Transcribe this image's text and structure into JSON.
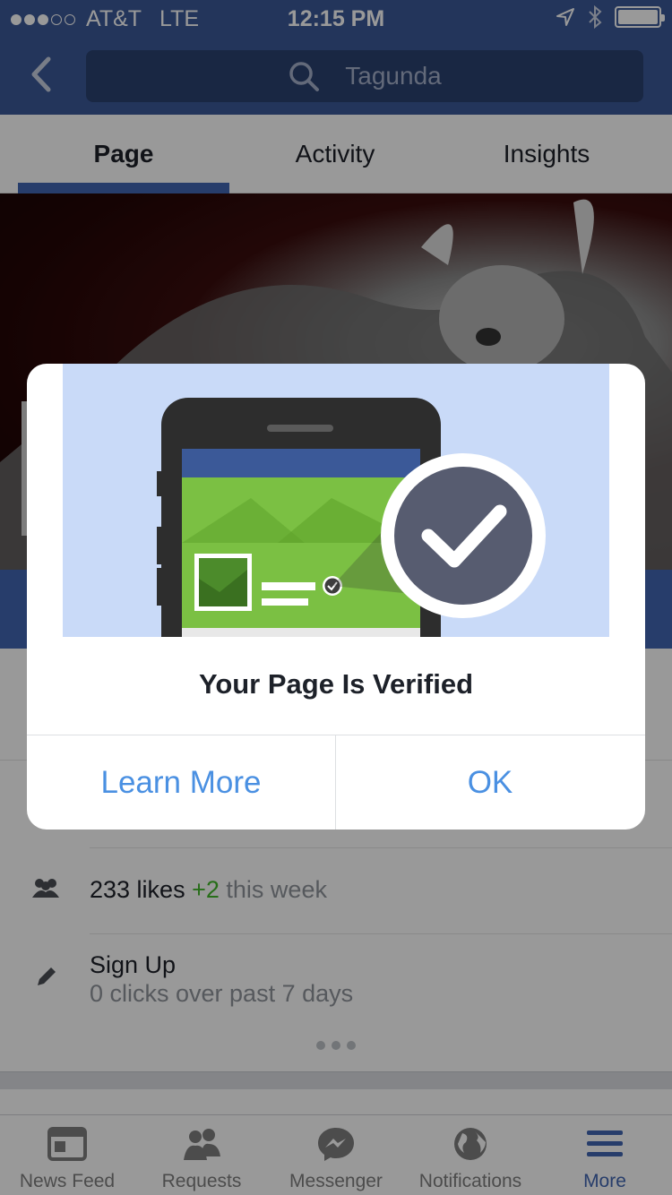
{
  "status_bar": {
    "carrier": "AT&T",
    "network": "LTE",
    "time": "12:15 PM"
  },
  "search": {
    "query": "Tagunda"
  },
  "tabs": [
    {
      "label": "Page"
    },
    {
      "label": "Activity"
    },
    {
      "label": "Insights"
    }
  ],
  "stats": {
    "likes_count": "233 likes",
    "likes_delta": "+2",
    "likes_period": "this week",
    "signup_title": "Sign Up",
    "signup_sub": "0 clicks over past 7 days"
  },
  "modal": {
    "title": "Your Page Is Verified",
    "learn_more": "Learn More",
    "ok": "OK"
  },
  "tabbar": [
    {
      "label": "News Feed",
      "icon": "news-feed-icon"
    },
    {
      "label": "Requests",
      "icon": "requests-icon"
    },
    {
      "label": "Messenger",
      "icon": "messenger-icon"
    },
    {
      "label": "Notifications",
      "icon": "globe-icon"
    },
    {
      "label": "More",
      "icon": "menu-icon"
    }
  ],
  "colors": {
    "brand": "#3b5998",
    "accent": "#4267b2",
    "link": "#4a90e2",
    "green": "#42b72a"
  }
}
